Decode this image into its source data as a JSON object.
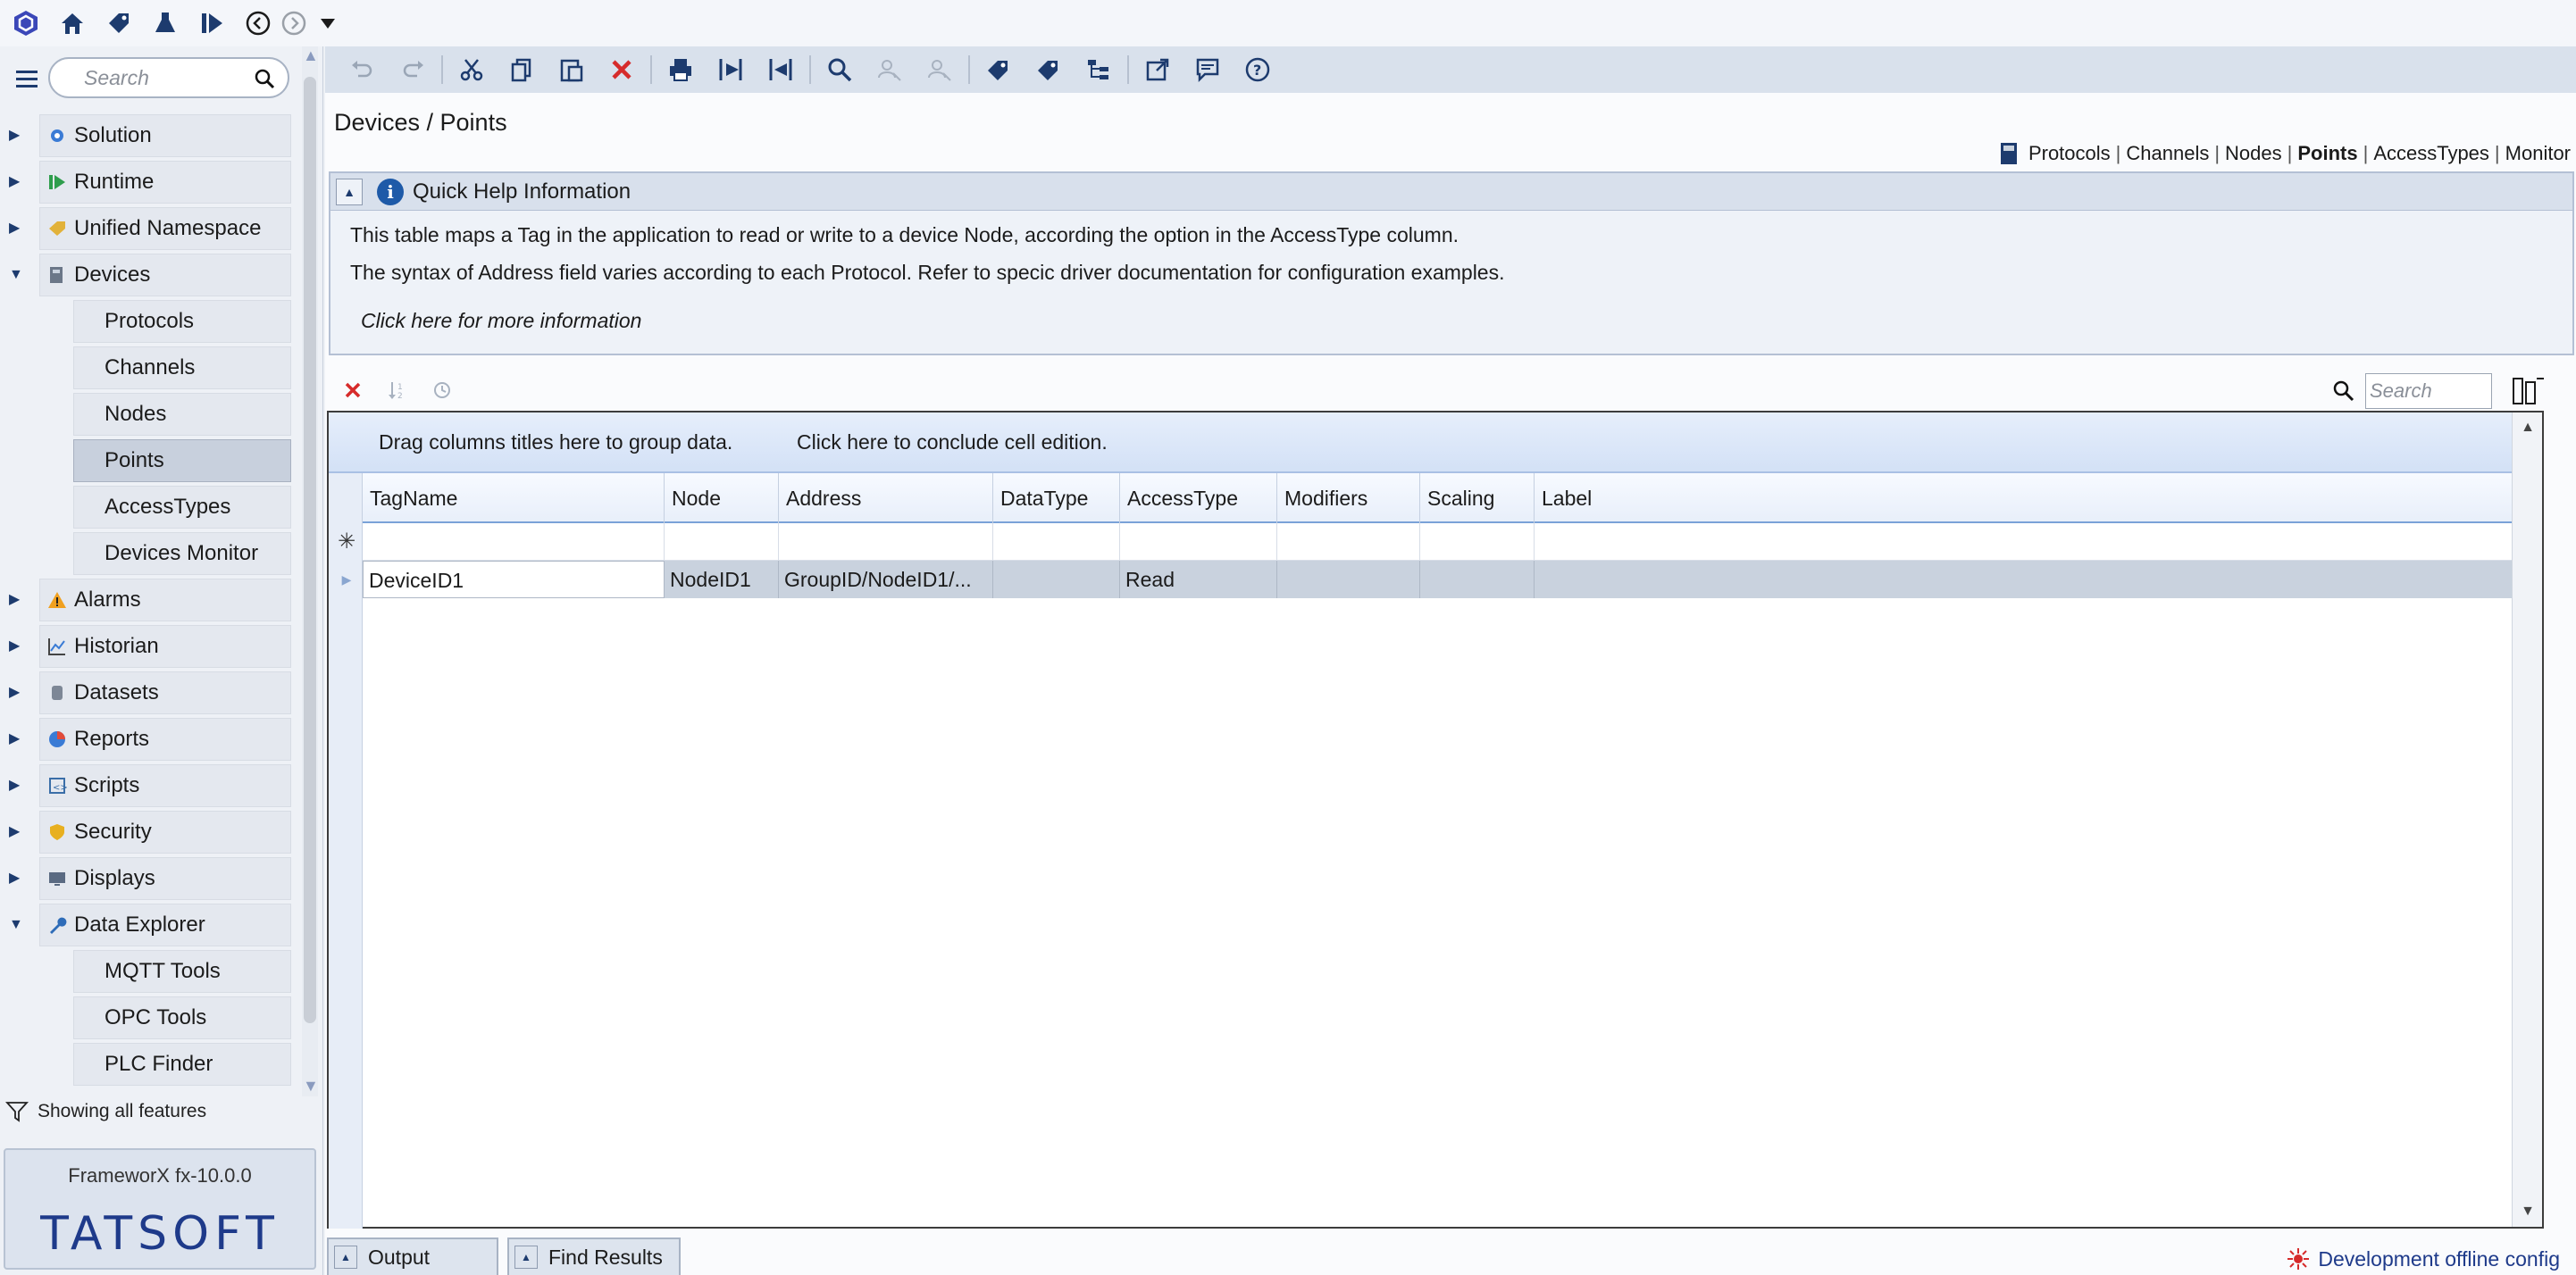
{
  "topbar": {
    "icons": [
      "app-logo-icon",
      "home-icon",
      "solution-tag-icon",
      "flask-icon",
      "run-icon",
      "back-icon",
      "forward-icon",
      "dropdown-icon"
    ]
  },
  "nav": {
    "search_placeholder": "Search",
    "items": [
      {
        "label": "Solution"
      },
      {
        "label": "Runtime"
      },
      {
        "label": "Unified Namespace"
      },
      {
        "label": "Devices"
      },
      {
        "label": "Protocols"
      },
      {
        "label": "Channels"
      },
      {
        "label": "Nodes"
      },
      {
        "label": "Points"
      },
      {
        "label": "AccessTypes"
      },
      {
        "label": "Devices Monitor"
      },
      {
        "label": "Alarms"
      },
      {
        "label": "Historian"
      },
      {
        "label": "Datasets"
      },
      {
        "label": "Reports"
      },
      {
        "label": "Scripts"
      },
      {
        "label": "Security"
      },
      {
        "label": "Displays"
      },
      {
        "label": "Data Explorer"
      },
      {
        "label": "MQTT Tools"
      },
      {
        "label": "OPC Tools"
      },
      {
        "label": "PLC Finder"
      }
    ],
    "filter_text": "Showing all features",
    "brand_version": "FrameworX fx-10.0.0",
    "brand_logo": "TATSOFT"
  },
  "main": {
    "title": "Devices / Points",
    "section_nav": [
      "Protocols",
      "Channels",
      "Nodes",
      "Points",
      "AccessTypes",
      "Monitor"
    ],
    "section_sep": "|",
    "quick_help": {
      "title": "Quick Help Information",
      "line1": "This table maps a Tag in the application to read or write to a device Node, according the option in the AccessType column.",
      "line2": "The syntax of Address field varies according to each Protocol. Refer to specic driver documentation for configuration examples.",
      "link": "Click here for more information"
    },
    "grid_search_placeholder": "Search",
    "grid": {
      "group_hint": "Drag columns titles here to group data.",
      "conclude_hint": "Click here to conclude cell edition.",
      "columns": [
        "TagName",
        "Node",
        "Address",
        "DataType",
        "AccessType",
        "Modifiers",
        "Scaling",
        "Label"
      ],
      "rows": [
        [
          "DeviceID1",
          "NodeID1",
          "GroupID/NodeID1/...",
          "",
          "Read",
          "",
          "",
          ""
        ]
      ]
    }
  },
  "bottom": {
    "tabs": [
      "Output",
      "Find Results"
    ],
    "status": "Development offline config"
  },
  "colors": {
    "accent": "#1e3a8a",
    "selected_row": "#c9d2de",
    "delete_red": "#d62b2b"
  }
}
